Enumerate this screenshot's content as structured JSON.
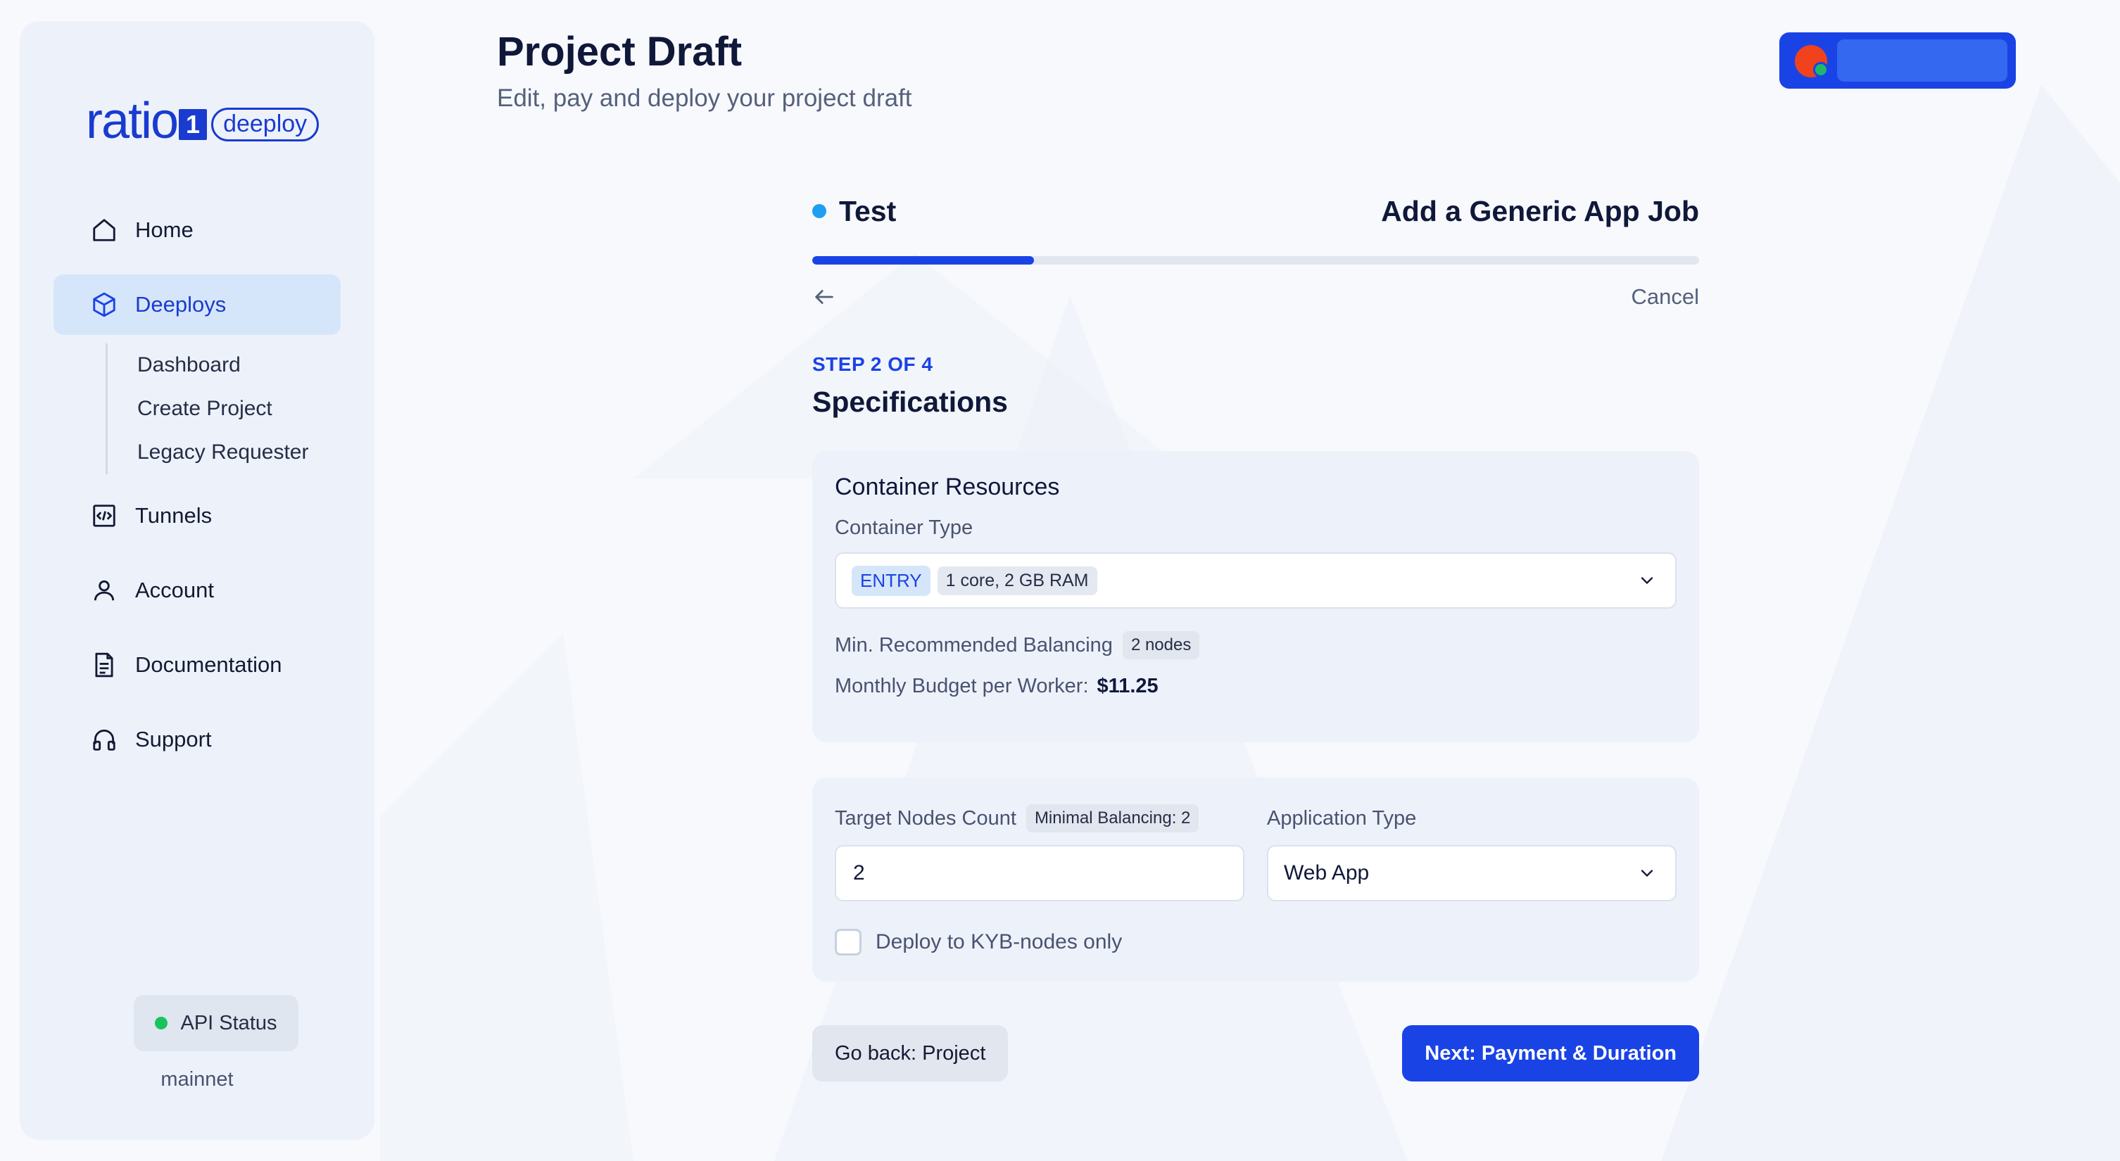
{
  "sidebar": {
    "logo": {
      "word": "ratio",
      "digit": "1",
      "badge": "deeploy"
    },
    "nav": {
      "home": "Home",
      "deeploys": "Deeploys",
      "deeploys_sub": [
        "Dashboard",
        "Create Project",
        "Legacy Requester"
      ],
      "tunnels": "Tunnels",
      "account": "Account",
      "documentation": "Documentation",
      "support": "Support"
    },
    "api_status": "API Status",
    "network": "mainnet"
  },
  "header": {
    "title": "Project Draft",
    "subtitle": "Edit, pay and deploy your project draft"
  },
  "wizard": {
    "project_name": "Test",
    "job_title": "Add a Generic App Job",
    "progress": 0.25,
    "cancel": "Cancel",
    "step_label": "STEP 2 OF 4",
    "step_title": "Specifications"
  },
  "container_resources": {
    "title": "Container Resources",
    "type_label": "Container Type",
    "type_tier": "ENTRY",
    "type_spec": "1 core, 2 GB RAM",
    "min_balancing_label": "Min. Recommended Balancing",
    "min_balancing_value": "2 nodes",
    "budget_label": "Monthly Budget per Worker:",
    "budget_value": "$11.25"
  },
  "deployment": {
    "target_nodes_label": "Target Nodes Count",
    "minimal_balancing": "Minimal Balancing: 2",
    "target_nodes_value": "2",
    "app_type_label": "Application Type",
    "app_type_value": "Web App",
    "kyb_label": "Deploy to KYB-nodes only"
  },
  "actions": {
    "back": "Go back: Project",
    "next": "Next: Payment & Duration"
  },
  "colors": {
    "accent": "#1a43e6",
    "sidebar_bg": "#edf2fa",
    "status_green": "#19c35c",
    "project_dot": "#1e9ff2"
  }
}
